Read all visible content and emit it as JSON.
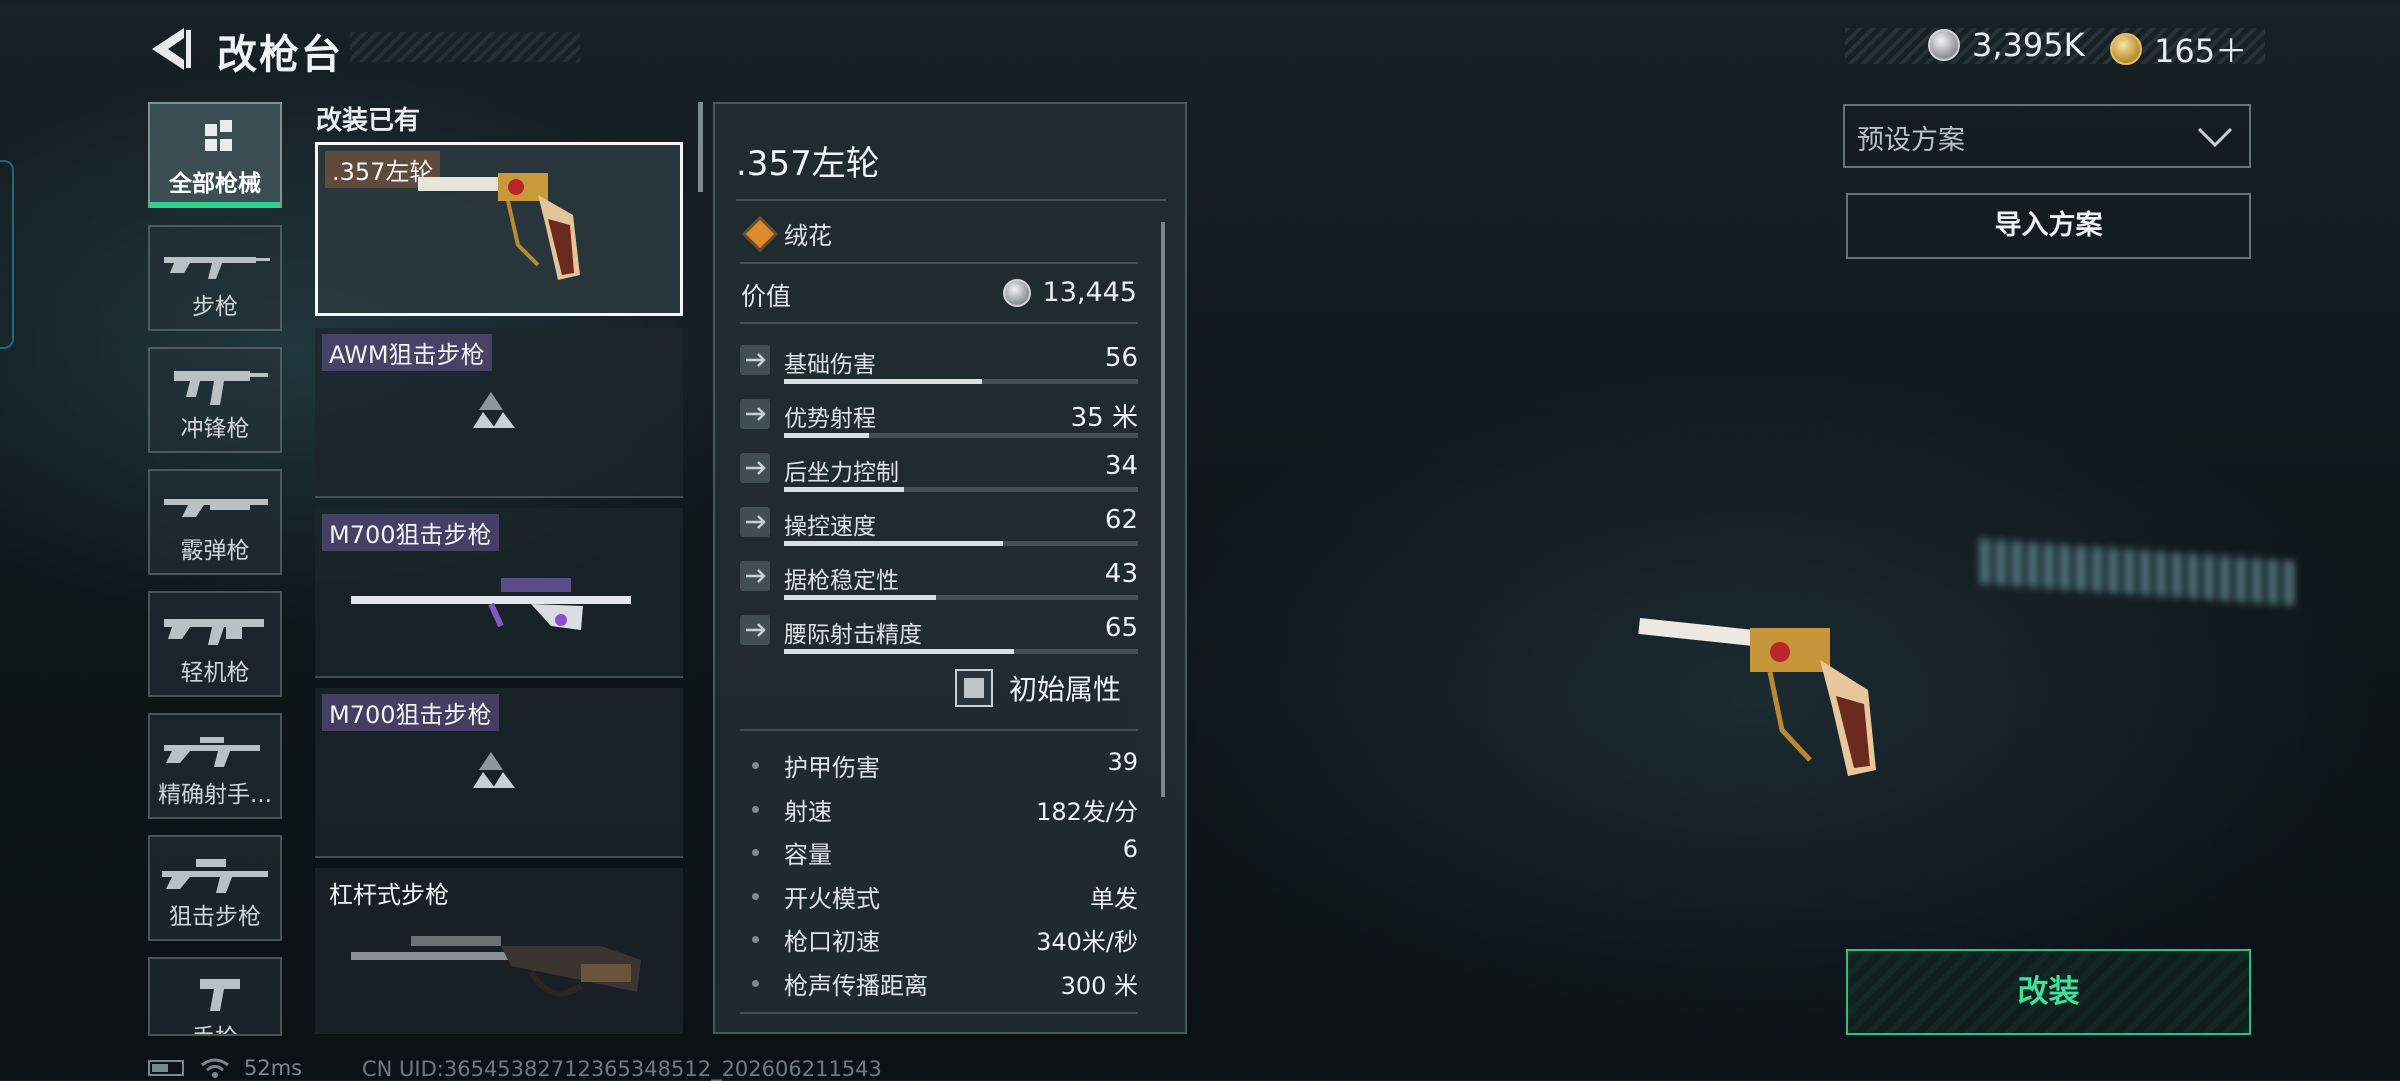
{
  "header": {
    "title": "改枪台",
    "currency": [
      {
        "icon": "silver-coin-icon",
        "value": "3,395K"
      },
      {
        "icon": "gold-coin-icon",
        "value": "165＋"
      }
    ]
  },
  "categories": [
    {
      "label": "全部枪械",
      "icon": "all-weapons-icon",
      "active": true
    },
    {
      "label": "步枪",
      "icon": "rifle-icon"
    },
    {
      "label": "冲锋枪",
      "icon": "smg-icon"
    },
    {
      "label": "霰弹枪",
      "icon": "shotgun-icon"
    },
    {
      "label": "轻机枪",
      "icon": "lmg-icon"
    },
    {
      "label": "精确射手...",
      "icon": "marksman-rifle-icon"
    },
    {
      "label": "狙击步枪",
      "icon": "sniper-rifle-icon"
    },
    {
      "label": "手枪",
      "icon": "pistol-icon"
    }
  ],
  "weapon_list": {
    "title": "改装已有",
    "items": [
      {
        "name": ".357左轮",
        "selected": true
      },
      {
        "name": "AWM狙击步枪"
      },
      {
        "name": "M700狙击步枪"
      },
      {
        "name": "M700狙击步枪"
      },
      {
        "name": "杠杆式步枪"
      }
    ]
  },
  "detail": {
    "name": ".357左轮",
    "rarity": "绒花",
    "value_label": "价值",
    "value": "13,445",
    "stats": [
      {
        "name": "基础伤害",
        "value": "56",
        "level": 0.56,
        "icon": "damage-icon"
      },
      {
        "name": "优势射程",
        "value": "35 米",
        "level": 0.24,
        "icon": "range-icon"
      },
      {
        "name": "后坐力控制",
        "value": "34",
        "level": 0.34,
        "icon": "recoil-icon"
      },
      {
        "name": "操控速度",
        "value": "62",
        "level": 0.62,
        "icon": "handling-icon"
      },
      {
        "name": "据枪稳定性",
        "value": "43",
        "level": 0.43,
        "icon": "stability-icon"
      },
      {
        "name": "腰际射击精度",
        "value": "65",
        "level": 0.65,
        "icon": "hipfire-icon"
      }
    ],
    "initial_attributes_label": "初始属性",
    "specs": [
      {
        "name": "护甲伤害",
        "value": "39"
      },
      {
        "name": "射速",
        "value": "182发/分"
      },
      {
        "name": "容量",
        "value": "6"
      },
      {
        "name": "开火模式",
        "value": "单发"
      },
      {
        "name": "枪口初速",
        "value": "340米/秒"
      },
      {
        "name": "枪声传播距离",
        "value": "300 米"
      }
    ]
  },
  "right": {
    "preset_placeholder": "预设方案",
    "import_label": "导入方案",
    "modify_label": "改装"
  },
  "status_bar": {
    "ping": "52ms",
    "uid": "CN UID:3654538271236534851​2_202606211543"
  },
  "colors": {
    "accent_green": "#2fd08a",
    "rarity_orange": "#e08a2a"
  }
}
